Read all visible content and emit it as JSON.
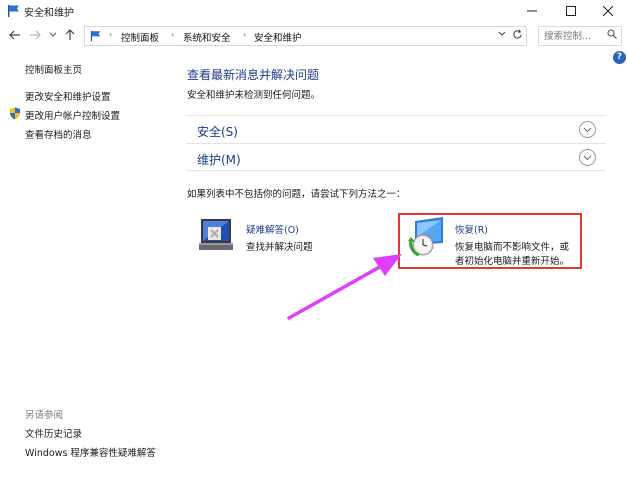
{
  "window": {
    "title": "安全和维护",
    "min_icon": "minimize-icon",
    "max_icon": "maximize-icon",
    "close_icon": "close-icon"
  },
  "address": {
    "crumbs": [
      "控制面板",
      "系统和安全",
      "安全和维护"
    ],
    "search_placeholder": "搜索控制...",
    "search_icon": "search-icon"
  },
  "leftnav": {
    "items": [
      "控制面板主页",
      "更改安全和维护设置",
      "更改用户帐户控制设置",
      "查看存档的消息"
    ],
    "see_also_label": "另请参阅",
    "see_also": [
      "文件历史记录",
      "Windows 程序兼容性疑难解答"
    ]
  },
  "main": {
    "heading": "查看最新消息并解决问题",
    "subtitle": "安全和维护未检测到任何问题。",
    "sections": [
      "安全(S)",
      "维护(M)"
    ],
    "if_text": "如果列表中不包括你的问题，请尝试下列方法之一：",
    "troubleshoot": {
      "title": "疑难解答(O)",
      "desc": "查找并解决问题"
    },
    "recovery": {
      "title": "恢复(R)",
      "desc_line1": "恢复电脑而不影响文件，或",
      "desc_line2": "者初始化电脑并重新开始。"
    }
  },
  "colors": {
    "link_blue": "#1e3c8c",
    "highlight_red": "#e53834",
    "arrow_magenta": "#e040fb",
    "help_blue": "#2565b8"
  }
}
